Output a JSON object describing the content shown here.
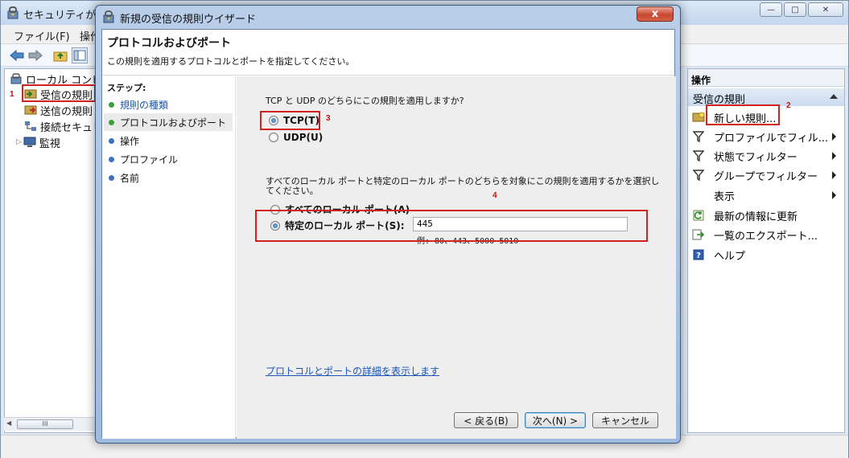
{
  "bg_window": {
    "title": "セキュリティが強",
    "menu": [
      "ファイル(F)",
      "操作"
    ],
    "tree": [
      {
        "label": "ローカル コンピ",
        "icon": "firewall-icon"
      },
      {
        "label": "受信の規則",
        "icon": "inbound-rules-icon"
      },
      {
        "label": "送信の規則",
        "icon": "outbound-rules-icon"
      },
      {
        "label": "接続セキュリ",
        "icon": "connection-security-icon"
      },
      {
        "label": "監視",
        "icon": "monitor-icon"
      }
    ],
    "scroll_grip": "III",
    "actions": {
      "header": "操作",
      "section": "受信の規則",
      "items": [
        {
          "label": "新しい規則...",
          "icon": "new-rule-icon",
          "submenu": false
        },
        {
          "label": "プロファイルでフィル...",
          "icon": "filter-icon",
          "submenu": true
        },
        {
          "label": "状態でフィルター",
          "icon": "filter-icon",
          "submenu": true
        },
        {
          "label": "グループでフィルター",
          "icon": "filter-icon",
          "submenu": true
        },
        {
          "label": "表示",
          "icon": "",
          "submenu": true
        },
        {
          "label": "最新の情報に更新",
          "icon": "refresh-icon",
          "submenu": false
        },
        {
          "label": "一覧のエクスポート...",
          "icon": "export-icon",
          "submenu": false
        },
        {
          "label": "ヘルプ",
          "icon": "help-icon",
          "submenu": false
        }
      ]
    }
  },
  "dialog": {
    "title": "新規の受信の規則ウイザード",
    "close_label": "x",
    "header_title": "プロトコルおよびポート",
    "header_subtitle": "この規則を適用するプロトコルとポートを指定してください。",
    "steps_title": "ステップ:",
    "steps": [
      {
        "label": "規則の種類",
        "state": "done"
      },
      {
        "label": "プロトコルおよびポート",
        "state": "current"
      },
      {
        "label": "操作",
        "state": "pending"
      },
      {
        "label": "プロファイル",
        "state": "pending"
      },
      {
        "label": "名前",
        "state": "pending"
      }
    ],
    "question_protocol": "TCP と UDP のどちらにこの規則を適用しますか?",
    "tcp_label": "TCP(T)",
    "udp_label": "UDP(U)",
    "question_ports_line1": "すべてのローカル ポートと特定のローカル ポートのどちらを対象にこの規則を適用するかを選択し",
    "question_ports_line2": "てください。",
    "all_ports_label": "すべてのローカル ポート(A)",
    "specific_ports_label": "特定のローカル ポート(S):",
    "port_value": "445",
    "port_example": "例: 80、443、5000-5010",
    "details_link": "プロトコルとポートの詳細を表示します",
    "back_label": "< 戻る(B)",
    "next_label": "次へ(N) >",
    "cancel_label": "キャンセル",
    "selected_protocol": "TCP",
    "selected_ports": "specific"
  },
  "annotations": [
    "1",
    "2",
    "3",
    "4"
  ],
  "colors": {
    "annotation": "#d32020",
    "link": "#1a55b5",
    "step_done": "#3aa13a",
    "step_pending": "#3a6fc4"
  }
}
